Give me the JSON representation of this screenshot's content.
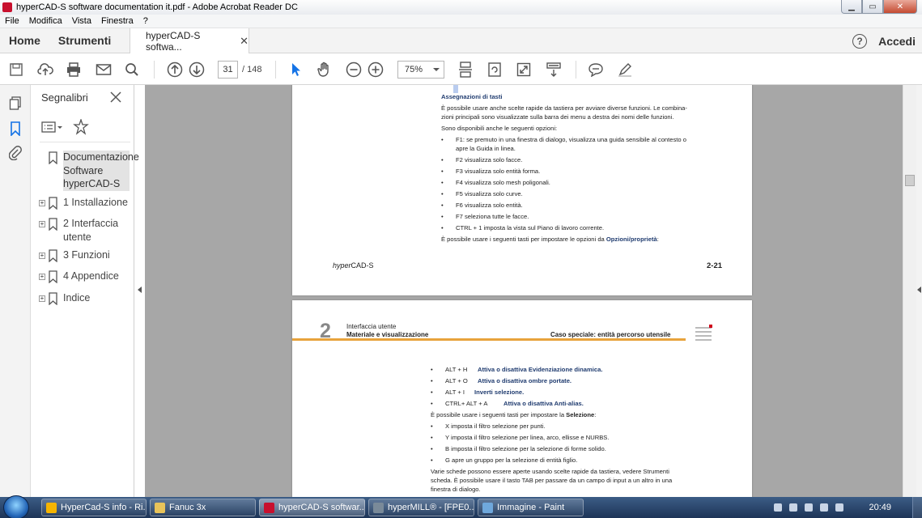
{
  "window": {
    "title": "hyperCAD-S software documentation it.pdf - Adobe Acrobat Reader DC"
  },
  "menu": [
    "File",
    "Modifica",
    "Vista",
    "Finestra",
    "?"
  ],
  "tabs": {
    "home": "Home",
    "tools": "Strumenti",
    "document": "hyperCAD-S softwa...",
    "signin": "Accedi"
  },
  "toolbar": {
    "current_page": "31",
    "page_total": "/ 148",
    "zoom": "75%"
  },
  "bookmarks": {
    "title": "Segnalibri",
    "items": [
      {
        "label": "Documentazione Software hyperCAD-S",
        "expandable": false,
        "selected": true
      },
      {
        "label": "1 Installazione",
        "expandable": true
      },
      {
        "label": "2 Interfaccia utente",
        "expandable": true
      },
      {
        "label": "3 Funzioni",
        "expandable": true
      },
      {
        "label": "4 Appendice",
        "expandable": true
      },
      {
        "label": "Indice",
        "expandable": true
      }
    ]
  },
  "page1": {
    "heading": "Assegnazioni di tasti",
    "intro1": "È possibile usare anche scelte rapide da tastiera per avviare diverse funzioni. Le combina-",
    "intro2": "zioni principali sono visualizzate sulla barra dei menu a destra dei nomi delle funzioni.",
    "options_intro": "Sono disponibili anche le seguenti opzioni:",
    "f1_line1": "F1: se premuto in una finestra di dialogo, visualizza una guida sensibile al contesto o",
    "f1_line2": "apre la Guida in linea.",
    "bullets": [
      "F2    visualizza solo facce.",
      "F3    visualizza solo entità forma.",
      "F4    visualizza solo mesh poligonali.",
      "F5    visualizza solo curve.",
      "F6    visualizza solo entità.",
      "F7    seleziona tutte le facce.",
      "CTRL + 1  imposta la vista sul Piano di lavoro corrente."
    ],
    "props_text": "È possibile usare i seguenti tasti per impostare le opzioni da ",
    "props_bold": "Opzioni/proprietà",
    "props_end": ":",
    "footer_brand_italic": "hyper",
    "footer_brand": "CAD-S",
    "footer_page": "2-21"
  },
  "page2": {
    "chapter_num": "2",
    "chapter_title": "Interfaccia utente",
    "section_title": "Materiale e visualizzazione",
    "special_case": "Caso speciale: entità percorso utensile",
    "alt_bullets": [
      {
        "key": "ALT + H",
        "text": "Attiva o disattiva Evidenziazione dinamica."
      },
      {
        "key": "ALT + O",
        "text": "Attiva o disattiva ombre portate."
      },
      {
        "key": "ALT + I",
        "text": "Inverti selezione."
      },
      {
        "key": "CTRL+ ALT + A",
        "text": "Attiva o disattiva Anti-alias."
      }
    ],
    "selection_text": "È possibile usare i seguenti tasti per impostare la ",
    "selection_bold": "Selezione",
    "selection_end": ":",
    "sel_bullets": [
      "X    imposta il filtro selezione per punti.",
      "Y    imposta il filtro selezione per linea, arco, ellisse e NURBS.",
      "B    imposta il filtro selezione per la selezione di forme solido.",
      "G    apre un gruppo per la selezione di entità figlio."
    ],
    "tail1": "Varie schede possono essere aperte usando scelte rapide da tastiera, vedere Strumenti",
    "tail2": "scheda. È possibile usare il tasto TAB per passare da un campo di input a un altro in una",
    "tail3": "finestra di dialogo."
  },
  "taskbar": {
    "items": [
      {
        "label": "HyperCad-S info - Ri...",
        "color": "#f5b400"
      },
      {
        "label": "Fanuc 3x",
        "color": "#e8c35a"
      },
      {
        "label": "hyperCAD-S softwar...",
        "color": "#c8102e",
        "active": true
      },
      {
        "label": "hyperMILL® - [FPE0...",
        "color": "#7a8a99"
      },
      {
        "label": "Immagine - Paint",
        "color": "#6fa8dc"
      }
    ],
    "clock": "20:49"
  }
}
